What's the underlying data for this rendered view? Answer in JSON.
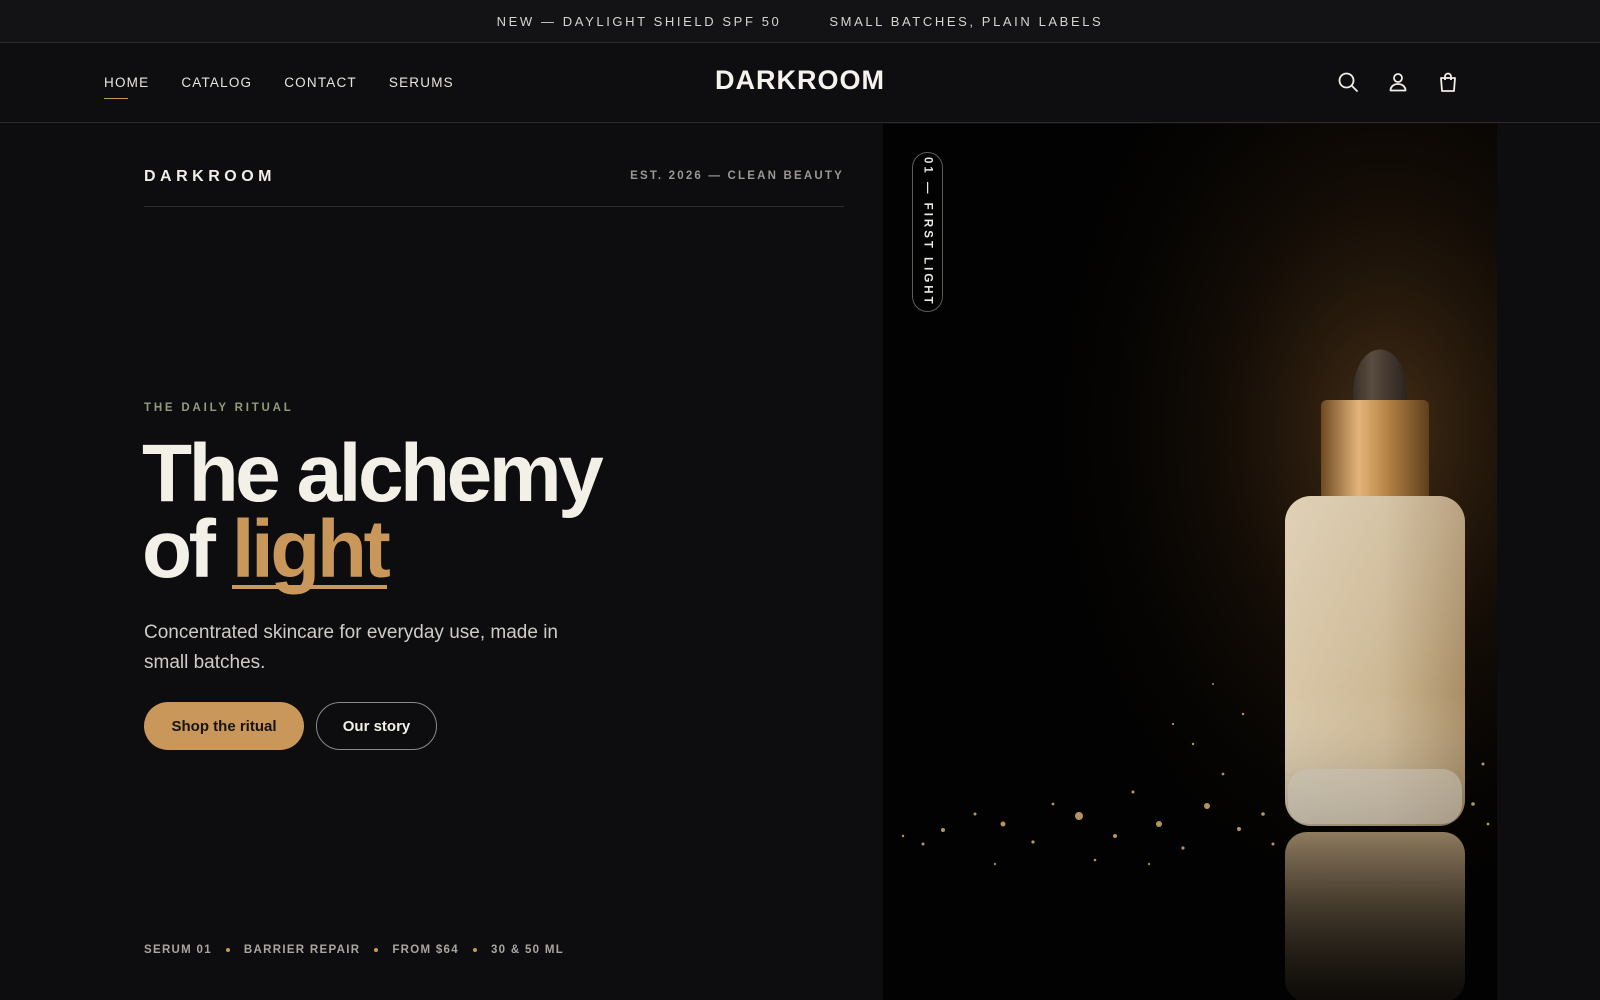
{
  "announcement": {
    "items": [
      "NEW — DAYLIGHT SHIELD SPF 50",
      "SMALL BATCHES, PLAIN LABELS"
    ]
  },
  "header": {
    "nav": [
      "HOME",
      "CATALOG",
      "CONTACT",
      "SERUMS"
    ],
    "active_nav": "HOME",
    "logo": "DARKROOM",
    "icons": [
      "search-icon",
      "account-icon",
      "bag-icon"
    ]
  },
  "hero": {
    "brand": "DARKROOM",
    "established": "EST. 2026 — CLEAN BEAUTY",
    "eyebrow": "THE DAILY RITUAL",
    "headline_line1": "The alchemy",
    "headline_line2_prefix": "of",
    "headline_accent": "light",
    "subtitle": "Concentrated skincare for everyday use, made in small batches.",
    "primary_cta": "Shop the ritual",
    "secondary_cta": "Our story",
    "meta": [
      "SERUM 01",
      "BARRIER REPAIR",
      "FROM $64",
      "30 & 50 ML"
    ],
    "image_tag": "01 — FIRST LIGHT"
  },
  "colors": {
    "background": "#0d0d0f",
    "accent": "#c9975a",
    "eyebrow": "#8f9b7c",
    "text": "#f3f0e8"
  }
}
